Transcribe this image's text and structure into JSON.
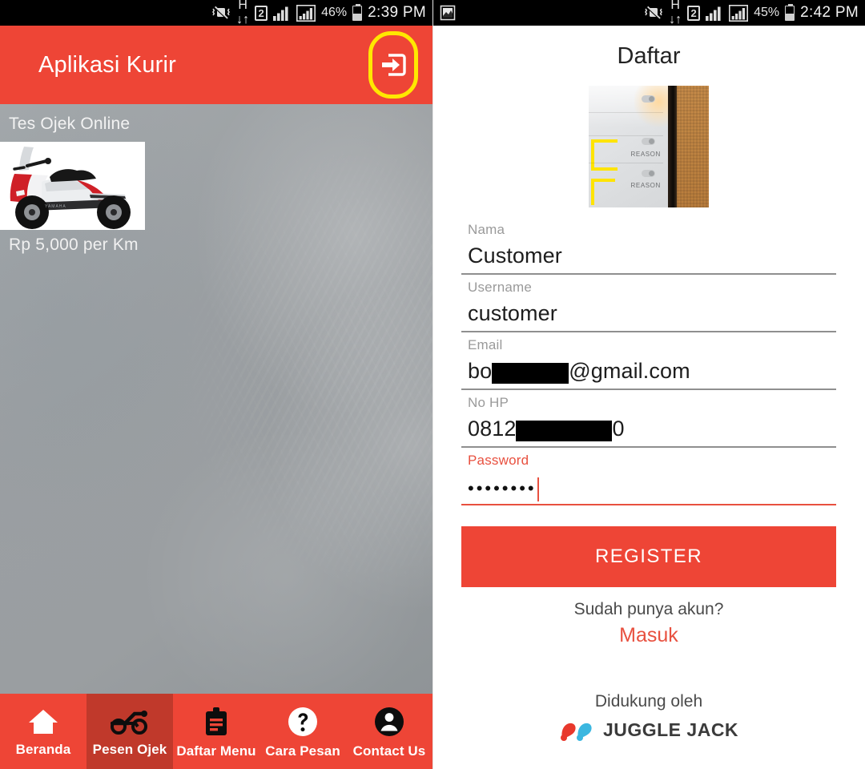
{
  "left_phone": {
    "statusbar": {
      "icons": [
        "vibrate-off-icon",
        "hspa-icon",
        "sim-2-icon",
        "signal-bars-icon",
        "signal-bars-boxed-icon"
      ],
      "sim_label": "2",
      "network_label": "H",
      "battery_percent": "46%",
      "time": "2:39 PM"
    },
    "appbar": {
      "title": "Aplikasi Kurir",
      "logout_icon": "logout-icon",
      "bg_color": "#ee4536",
      "highlight_color": "#ffe800"
    },
    "card": {
      "title": "Tes Ojek Online",
      "price": "Rp 5,000 per Km",
      "image_icon": "scooter-photo"
    },
    "bottom_nav": {
      "active_index": 1,
      "items": [
        {
          "label": "Beranda",
          "icon": "home-icon"
        },
        {
          "label": "Pesen Ojek",
          "icon": "motorbike-icon"
        },
        {
          "label": "Daftar Menu",
          "icon": "clipboard-list-icon"
        },
        {
          "label": "Cara Pesan",
          "icon": "question-circle-icon"
        },
        {
          "label": "Contact Us",
          "icon": "account-circle-icon"
        }
      ]
    }
  },
  "right_phone": {
    "statusbar": {
      "icons": [
        "screenshot-image-icon",
        "vibrate-off-icon",
        "hspa-icon",
        "sim-2-icon",
        "signal-bars-icon",
        "signal-bars-boxed-icon"
      ],
      "sim_label": "2",
      "network_label": "H",
      "battery_percent": "45%",
      "time": "2:42 PM"
    },
    "page_title": "Daftar",
    "avatar": {
      "icon": "profile-photo",
      "visible_text_1": "REASON",
      "visible_text_2": "REASON"
    },
    "form": {
      "fields": [
        {
          "label": "Nama",
          "value": "Customer",
          "error": false,
          "type": "text"
        },
        {
          "label": "Username",
          "value": "customer",
          "error": false,
          "type": "text"
        },
        {
          "label": "Email",
          "value_prefix": "bo",
          "value_suffix": "@gmail.com",
          "redacted": true,
          "error": false,
          "type": "email"
        },
        {
          "label": "No HP",
          "value_prefix": "0812",
          "value_suffix": "0",
          "redacted": true,
          "error": false,
          "type": "tel"
        },
        {
          "label": "Password",
          "value": "••••••••",
          "error": true,
          "type": "password",
          "focused": true
        }
      ]
    },
    "register_button": "REGISTER",
    "have_account_text": "Sudah punya akun?",
    "login_link": "Masuk",
    "supported_by_text": "Didukung oleh",
    "brand_name": "JUGGLE JACK",
    "brand_icon": "juggle-jack-logo",
    "accent_color": "#ee4536",
    "error_color": "#e8503f"
  }
}
